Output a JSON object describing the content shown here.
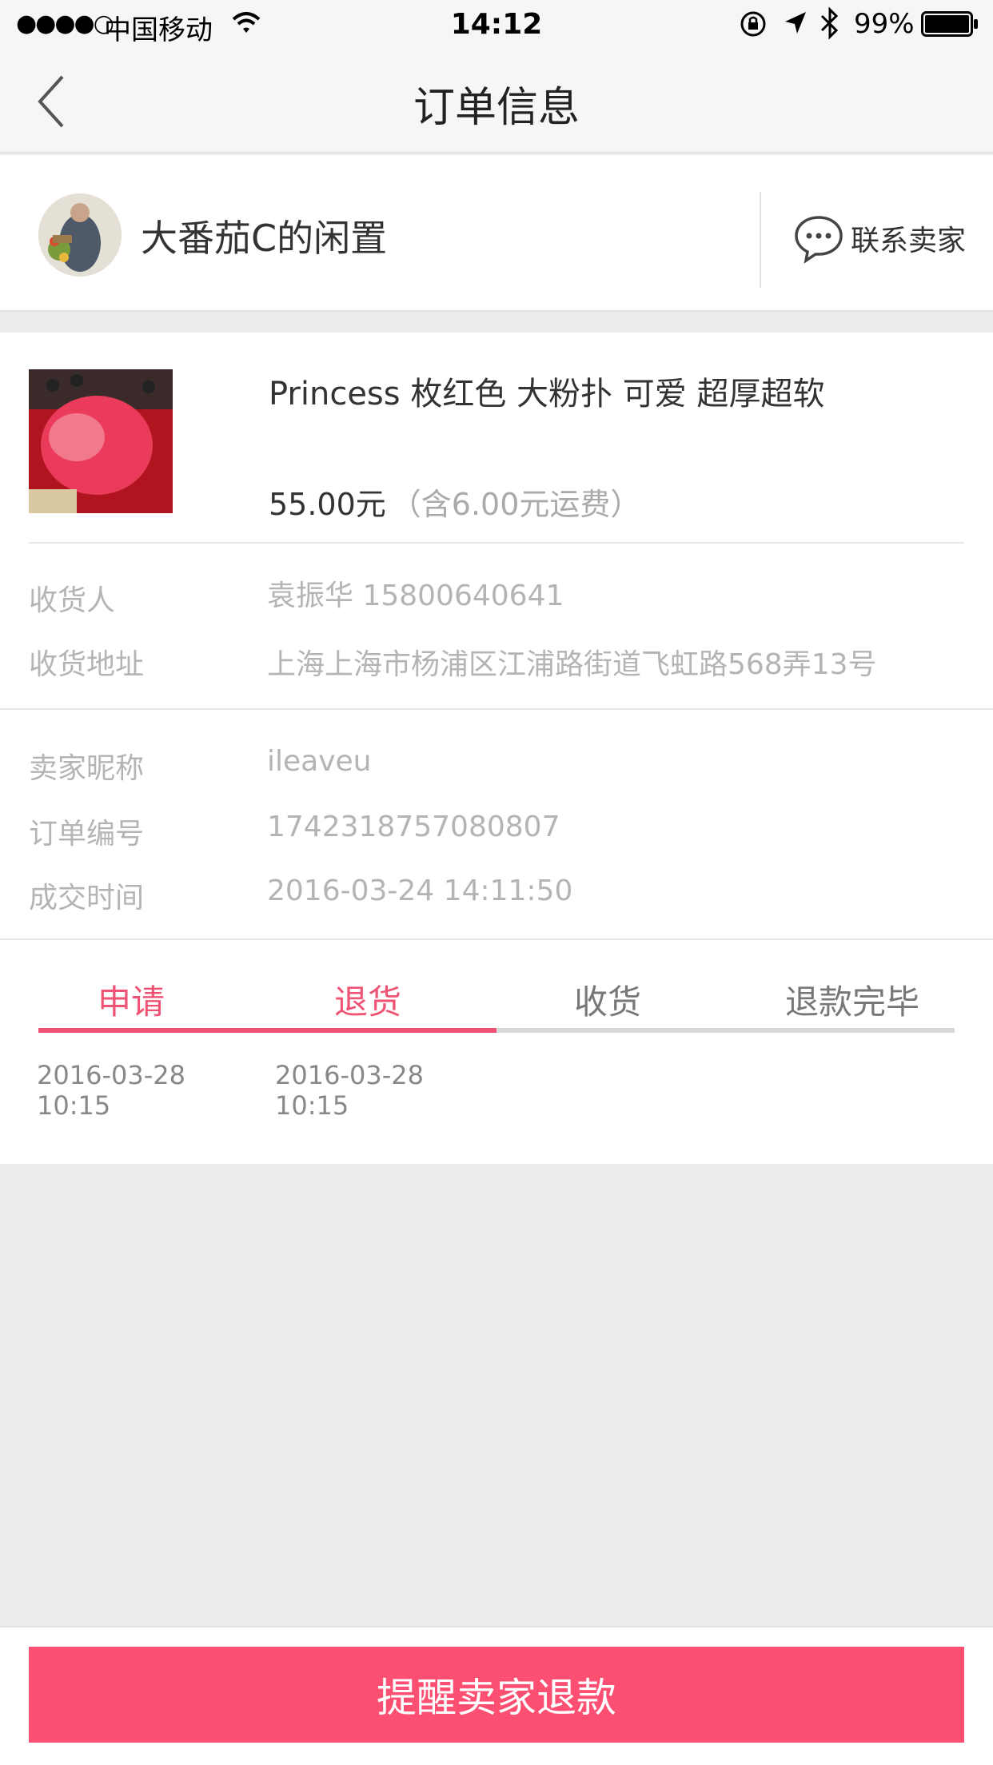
{
  "status_bar": {
    "signal": "●●●●○",
    "carrier": "中国移动",
    "time": "14:12",
    "battery_pct": "99%",
    "icons": [
      "wifi-icon",
      "orientation-lock-icon",
      "location-icon",
      "bluetooth-icon",
      "battery-icon"
    ]
  },
  "nav": {
    "title": "订单信息",
    "back_icon": "chevron-left-icon"
  },
  "seller": {
    "name": "大番茄C的闲置",
    "contact_label": "联系卖家",
    "contact_icon": "chat-bubble-icon"
  },
  "product": {
    "title": "Princess 枚红色 大粉扑 可爱 超厚超软",
    "price": "55.00元",
    "shipping": "（含6.00元运费）"
  },
  "shipping_info": {
    "receiver_label": "收货人",
    "receiver_value": "袁振华  15800640641",
    "address_label": "收货地址",
    "address_value": "上海上海市杨浦区江浦路街道飞虹路568弄13号"
  },
  "order_info": {
    "seller_nick_label": "卖家昵称",
    "seller_nick_value": "ileaveu",
    "order_no_label": "订单编号",
    "order_no_value": "1742318757080807",
    "deal_time_label": "成交时间",
    "deal_time_value": "2016-03-24 14:11:50"
  },
  "progress": {
    "steps": [
      {
        "label": "申请",
        "active": true,
        "date": "2016-03-28",
        "time": "10:15"
      },
      {
        "label": "退货",
        "active": true,
        "date": "2016-03-28",
        "time": "10:15"
      },
      {
        "label": "收货",
        "active": false
      },
      {
        "label": "退款完毕",
        "active": false
      }
    ],
    "completed_fraction": 0.5
  },
  "action": {
    "remind_label": "提醒卖家退款"
  },
  "colors": {
    "accent": "#f05274",
    "button": "#fc4f72",
    "background": "#ededed"
  }
}
